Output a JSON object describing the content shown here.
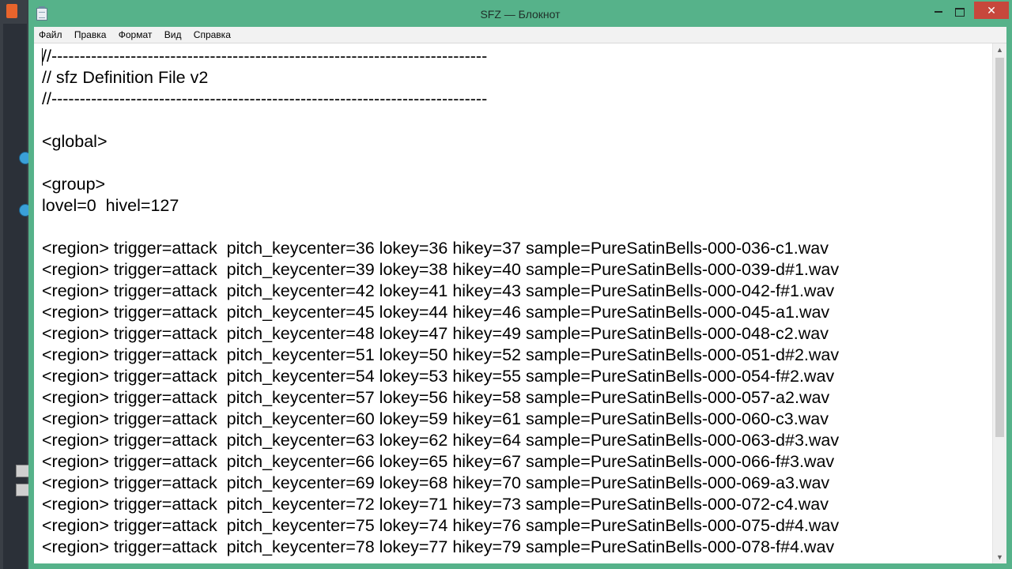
{
  "window": {
    "title": "SFZ — Блокнот",
    "controls": {
      "minimize": "minimize",
      "maximize": "maximize",
      "close": "✕"
    }
  },
  "menu": [
    "Файл",
    "Правка",
    "Формат",
    "Вид",
    "Справка"
  ],
  "editor": {
    "lines": [
      "//-----------------------------------------------------------------------------",
      "// sfz Definition File v2",
      "//-----------------------------------------------------------------------------",
      "",
      "<global>",
      "",
      "<group>",
      "lovel=0  hivel=127",
      "",
      "<region> trigger=attack  pitch_keycenter=36 lokey=36 hikey=37 sample=PureSatinBells-000-036-c1.wav",
      "<region> trigger=attack  pitch_keycenter=39 lokey=38 hikey=40 sample=PureSatinBells-000-039-d#1.wav",
      "<region> trigger=attack  pitch_keycenter=42 lokey=41 hikey=43 sample=PureSatinBells-000-042-f#1.wav",
      "<region> trigger=attack  pitch_keycenter=45 lokey=44 hikey=46 sample=PureSatinBells-000-045-a1.wav",
      "<region> trigger=attack  pitch_keycenter=48 lokey=47 hikey=49 sample=PureSatinBells-000-048-c2.wav",
      "<region> trigger=attack  pitch_keycenter=51 lokey=50 hikey=52 sample=PureSatinBells-000-051-d#2.wav",
      "<region> trigger=attack  pitch_keycenter=54 lokey=53 hikey=55 sample=PureSatinBells-000-054-f#2.wav",
      "<region> trigger=attack  pitch_keycenter=57 lokey=56 hikey=58 sample=PureSatinBells-000-057-a2.wav",
      "<region> trigger=attack  pitch_keycenter=60 lokey=59 hikey=61 sample=PureSatinBells-000-060-c3.wav",
      "<region> trigger=attack  pitch_keycenter=63 lokey=62 hikey=64 sample=PureSatinBells-000-063-d#3.wav",
      "<region> trigger=attack  pitch_keycenter=66 lokey=65 hikey=67 sample=PureSatinBells-000-066-f#3.wav",
      "<region> trigger=attack  pitch_keycenter=69 lokey=68 hikey=70 sample=PureSatinBells-000-069-a3.wav",
      "<region> trigger=attack  pitch_keycenter=72 lokey=71 hikey=73 sample=PureSatinBells-000-072-c4.wav",
      "<region> trigger=attack  pitch_keycenter=75 lokey=74 hikey=76 sample=PureSatinBells-000-075-d#4.wav",
      "<region> trigger=attack  pitch_keycenter=78 lokey=77 hikey=79 sample=PureSatinBells-000-078-f#4.wav"
    ]
  },
  "colors": {
    "frame": "#56b28a",
    "close_button": "#c7473c",
    "menubar": "#f2f2f2",
    "editor_bg": "#ffffff"
  },
  "icons": {
    "app": "notepad-icon",
    "scroll_up": "▲",
    "scroll_down": "▼"
  }
}
